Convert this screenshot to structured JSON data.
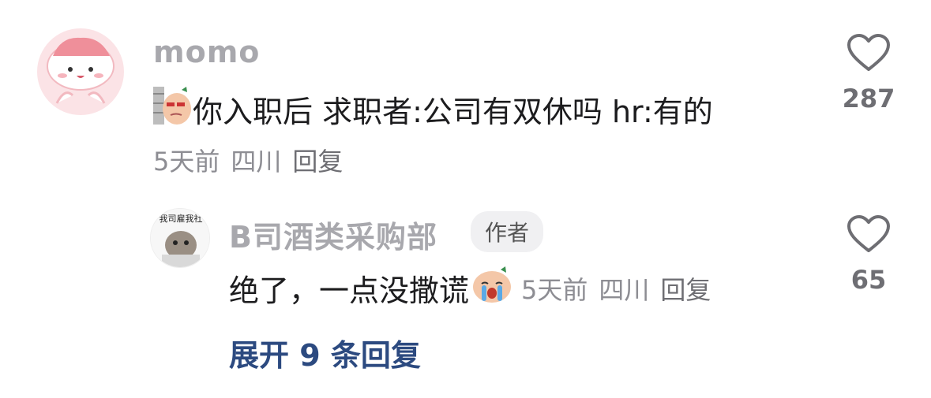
{
  "comment": {
    "username": "momo",
    "text": "你入职后 求职者:公司有双休吗 hr:有的",
    "time": "5天前",
    "location": "四川",
    "reply_label": "回复",
    "likes": "287"
  },
  "reply": {
    "username": "B司酒类采购部",
    "badge": "作者",
    "avatar_text": "我司雇我社",
    "text": "绝了，一点没撒谎",
    "time": "5天前",
    "location": "四川",
    "reply_label": "回复",
    "likes": "65"
  },
  "expand_label": "展开 9 条回复"
}
